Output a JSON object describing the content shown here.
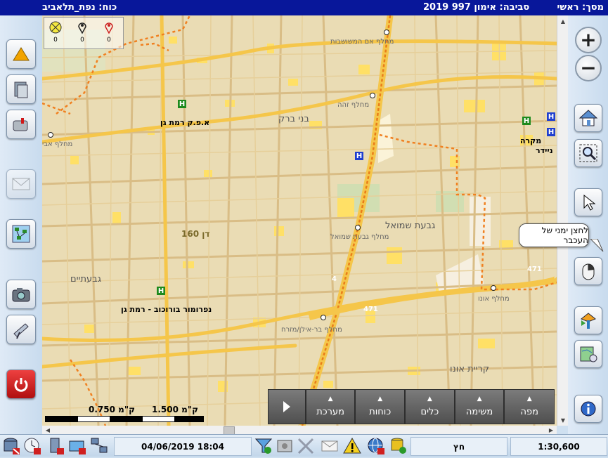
{
  "title_bar": {
    "screen": "מסך: ראשי",
    "environment": "סביבה: אימון 997 2019",
    "force": "כוח: נפת_תלאביב"
  },
  "legend": {
    "items": [
      {
        "icon": "crossed-circle-icon",
        "count": "0"
      },
      {
        "icon": "map-pin-icon",
        "count": "0"
      },
      {
        "icon": "map-pin-red-icon",
        "count": "0"
      }
    ]
  },
  "map": {
    "area_labels": {
      "bnei_brak": "בני ברק",
      "givat_shmuel": "גבעת שמואל",
      "givatayim": "גבעתיים",
      "kiryat_ono": "קריית אונו",
      "givat_shmuel_ic": "מחלף גבעת שמואל",
      "ono_ic": "מחלף אונו",
      "bar_ilan_ic": "מחלף בר-אילן/מזרח",
      "maccabi_ic": "מחלף אבי",
      "hamashvot_ic": "מחלף אם המשושבות",
      "zeeh_ic": "מחלף זהה"
    },
    "poi": {
      "apk": "א.פ.ק רמת גן",
      "borochov": "נפרומור בורוכוב - רמת גן",
      "mahara": "מקרה",
      "naider": "ניידר"
    },
    "road_labels": {
      "dan160": "דן 160",
      "r471a": "471",
      "r471b": "471",
      "r4": "4"
    },
    "hospital_letter": "H"
  },
  "scale": {
    "label_a": "ק\"מ 1.500",
    "label_b": "ק\"מ 0.750"
  },
  "menu": {
    "items": [
      "מפה",
      "משימה",
      "כלים",
      "כוחות",
      "מערכת"
    ]
  },
  "tooltip": "לחצן ימני של העכבר",
  "status": {
    "datetime": "04/06/2019 18:04",
    "arrow": "חץ",
    "scale_ratio": "1:30,600"
  },
  "colors": {
    "title_bg": "#08179a",
    "map_bg": "#eadcb4",
    "road_main": "#f5c64a",
    "road_minor": "#d9bd86",
    "highway_dash": "#f08020",
    "building": "#ffe066",
    "hospital_green": "#1d8a1d",
    "hospital_blue": "#1f3fcf"
  }
}
